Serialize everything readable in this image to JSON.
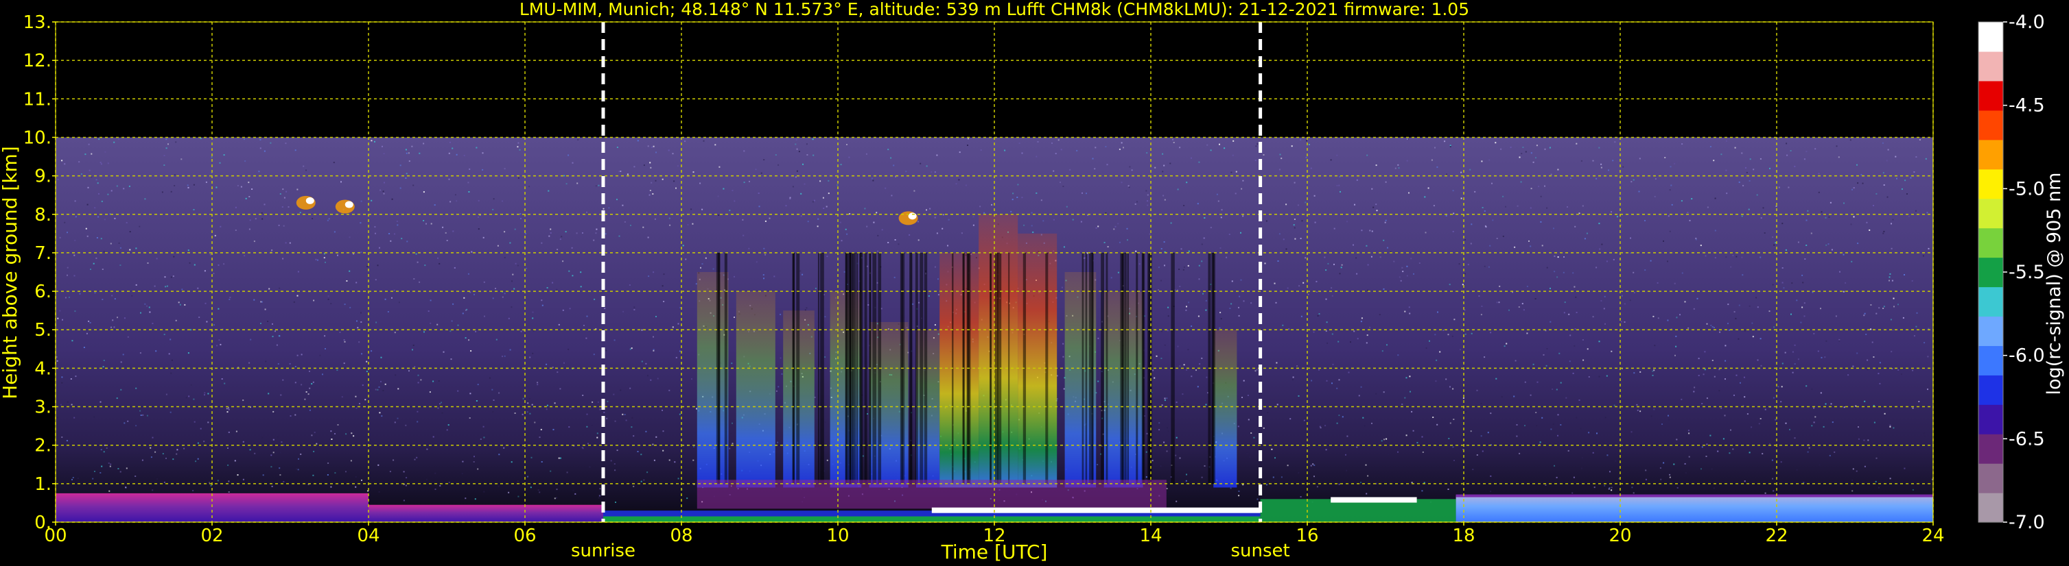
{
  "chart_data": {
    "type": "heatmap",
    "title": "LMU-MIM, Munich; 48.148° N 11.573° E, altitude: 539 m    Lufft CHM8k (CHM8kLMU): 21-12-2021    firmware: 1.05",
    "xlabel": "Time [UTC]",
    "ylabel": "Height above ground [km]",
    "xlim": [
      0,
      24
    ],
    "ylim": [
      0,
      13
    ],
    "x_ticks": [
      {
        "value": 0,
        "label": "00"
      },
      {
        "value": 2,
        "label": "02"
      },
      {
        "value": 4,
        "label": "04"
      },
      {
        "value": 6,
        "label": "06"
      },
      {
        "value": 8,
        "label": "08"
      },
      {
        "value": 10,
        "label": "10"
      },
      {
        "value": 12,
        "label": "12"
      },
      {
        "value": 14,
        "label": "14"
      },
      {
        "value": 16,
        "label": "16"
      },
      {
        "value": 18,
        "label": "18"
      },
      {
        "value": 20,
        "label": "20"
      },
      {
        "value": 22,
        "label": "22"
      },
      {
        "value": 24,
        "label": "24"
      }
    ],
    "y_ticks": [
      {
        "value": 0,
        "label": "0."
      },
      {
        "value": 1,
        "label": "1."
      },
      {
        "value": 2,
        "label": "2."
      },
      {
        "value": 3,
        "label": "3."
      },
      {
        "value": 4,
        "label": "4."
      },
      {
        "value": 5,
        "label": "5."
      },
      {
        "value": 6,
        "label": "6."
      },
      {
        "value": 7,
        "label": "7."
      },
      {
        "value": 8,
        "label": "8."
      },
      {
        "value": 9,
        "label": "9."
      },
      {
        "value": 10,
        "label": "10."
      },
      {
        "value": 11,
        "label": "11."
      },
      {
        "value": 12,
        "label": "12."
      },
      {
        "value": 13,
        "label": "13."
      }
    ],
    "grid": true,
    "measurement_top_km": 10,
    "events": [
      {
        "label": "sunrise",
        "time": 7.0
      },
      {
        "label": "sunset",
        "time": 15.4
      }
    ],
    "colorbar": {
      "label": "log(rc-signal) @ 905 nm",
      "range": [
        -7.0,
        -4.0
      ],
      "ticks": [
        "-4.0",
        "-4.5",
        "-5.0",
        "-5.5",
        "-6.0",
        "-6.5",
        "-7.0"
      ],
      "tick_values": [
        -4.0,
        -4.5,
        -5.0,
        -5.5,
        -6.0,
        -6.5,
        -7.0
      ],
      "colors": [
        "#a898a8",
        "#8c688c",
        "#6c2878",
        "#3c14a8",
        "#1e32e6",
        "#3c78ff",
        "#6ea8ff",
        "#3cc8d2",
        "#14a046",
        "#78d23c",
        "#d2f032",
        "#fff000",
        "#ffa000",
        "#ff4600",
        "#e60000",
        "#f2b4b4",
        "#ffffff"
      ]
    },
    "colors": {
      "background": "#000000",
      "text": "#ffff00",
      "grid": "#cccc00",
      "noise_base": "#3a2c6e"
    }
  }
}
